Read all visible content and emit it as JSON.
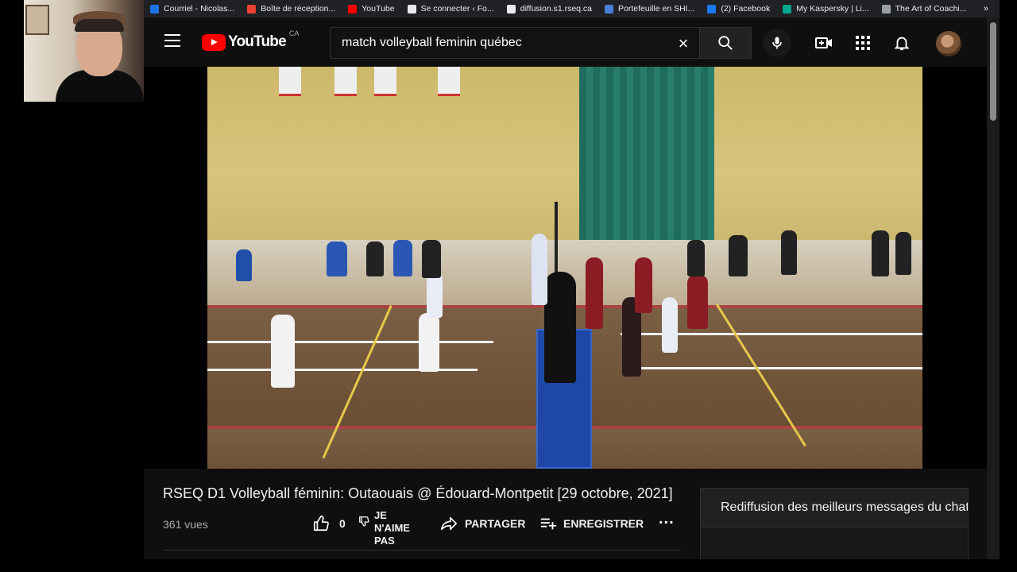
{
  "bookmarks": [
    {
      "label": "Courriel - Nicolas...",
      "color": "#1a73e8"
    },
    {
      "label": "Boîte de réception...",
      "color": "#ea4335"
    },
    {
      "label": "YouTube",
      "color": "#ff0000"
    },
    {
      "label": "Se connecter ‹ Fo...",
      "color": "#e8eaed"
    },
    {
      "label": "diffusion.s1.rseq.ca",
      "color": "#e8eaed"
    },
    {
      "label": "Portefeuille en SHI...",
      "color": "#4a7fd8"
    },
    {
      "label": "(2) Facebook",
      "color": "#1877f2"
    },
    {
      "label": "My Kaspersky | Li...",
      "color": "#00a88e"
    },
    {
      "label": "The Art of Coachi...",
      "color": "#9aa0a6"
    }
  ],
  "bookmarks_more": "»",
  "youtube": {
    "logo_text": "YouTube",
    "country": "CA",
    "search_value": "match volleyball feminin québec",
    "clear_glyph": "×"
  },
  "video": {
    "title": "RSEQ D1 Volleyball féminin: Outaouais @ Édouard-Montpetit [29 octobre, 2021]",
    "views": "361 vues",
    "likes": "0",
    "dislike_label_lines": [
      "JE",
      "N'AIME",
      "PAS"
    ],
    "share_label": "PARTAGER",
    "save_label": "ENREGISTRER",
    "more_glyph": "..."
  },
  "chat": {
    "header": "Rediffusion des meilleurs messages du chat"
  },
  "colors": {
    "youtube_red": "#ff0000",
    "page_bg": "#0f0f0f",
    "text": "#f1f1f1",
    "muted": "#aaaaaa"
  },
  "icons": [
    "menu-icon",
    "youtube-logo-icon",
    "close-icon",
    "search-icon",
    "mic-icon",
    "create-video-icon",
    "apps-icon",
    "bell-icon",
    "like-icon",
    "dislike-icon",
    "share-icon",
    "save-playlist-icon",
    "more-icon"
  ]
}
